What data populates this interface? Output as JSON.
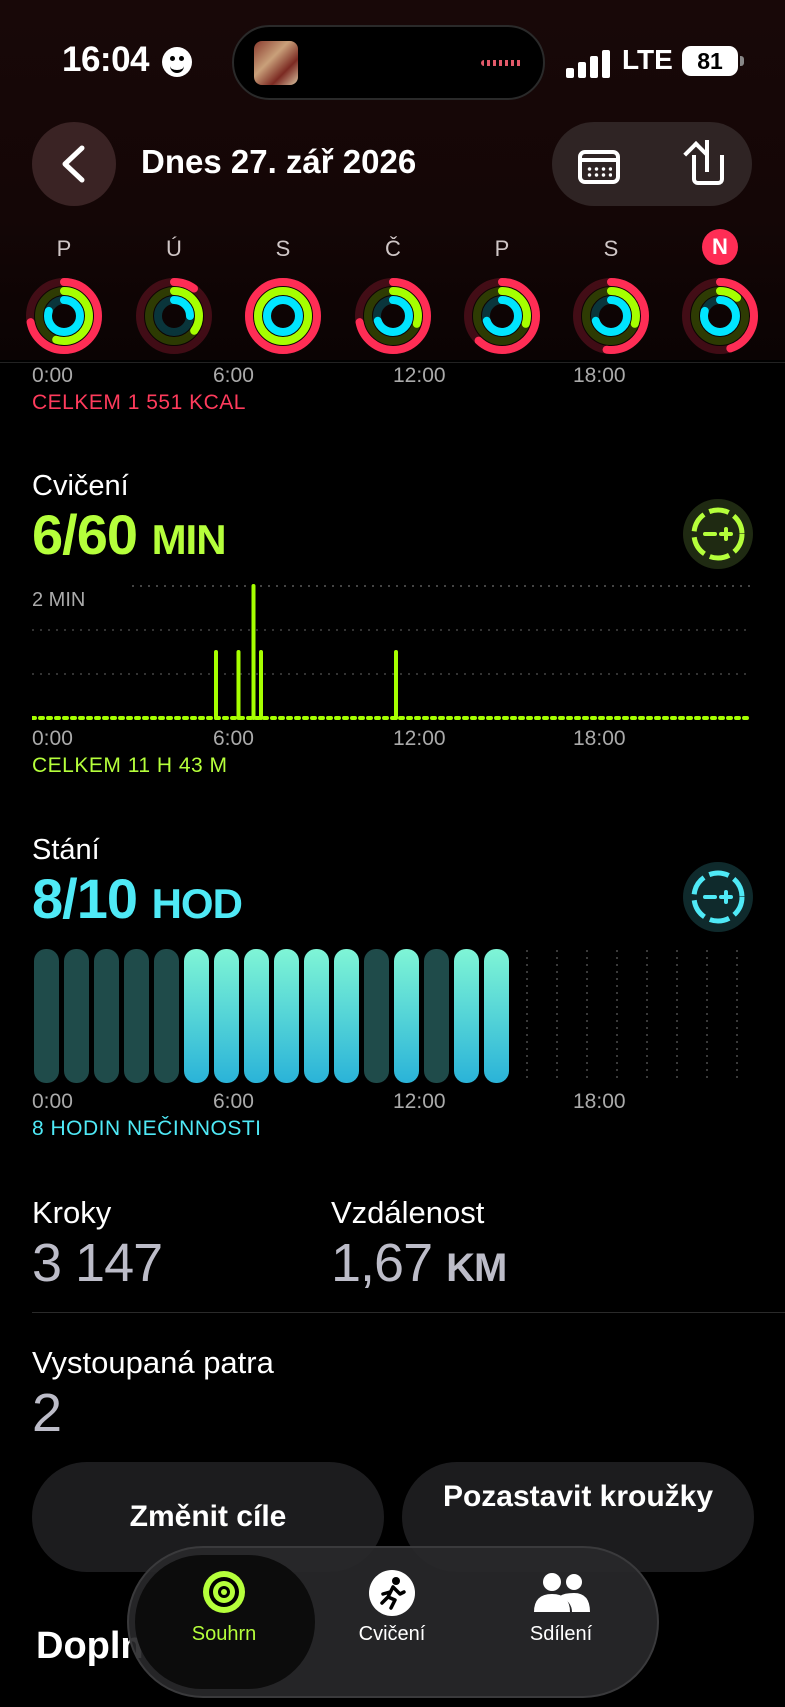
{
  "status_bar": {
    "time": "16:04",
    "network": "LTE",
    "battery": "81"
  },
  "header": {
    "title": "Dnes 27. zář 2026"
  },
  "week": {
    "days": [
      "P",
      "Ú",
      "S",
      "Č",
      "P",
      "S",
      "N"
    ],
    "rings": [
      {
        "move": 0.72,
        "exercise": 0.55,
        "stand": 0.8
      },
      {
        "move": 0.1,
        "exercise": 0.35,
        "stand": 0.25
      },
      {
        "move": 1.0,
        "exercise": 1.0,
        "stand": 1.0
      },
      {
        "move": 0.72,
        "exercise": 0.3,
        "stand": 0.7
      },
      {
        "move": 0.62,
        "exercise": 0.3,
        "stand": 0.7
      },
      {
        "move": 0.52,
        "exercise": 0.3,
        "stand": 0.7
      },
      {
        "move": 0.45,
        "exercise": 0.12,
        "stand": 0.8
      }
    ],
    "colors": {
      "move": "#ff2d55",
      "exercise": "#a6ff00",
      "stand": "#00e5ff"
    }
  },
  "move": {
    "time_axis": [
      "0:00",
      "6:00",
      "12:00",
      "18:00"
    ],
    "total": "CELKEM 1 551 KCAL"
  },
  "exercise": {
    "title": "Cvičení",
    "value": "6/60",
    "unit": "MIN",
    "time_axis": [
      "0:00",
      "6:00",
      "12:00",
      "18:00"
    ],
    "total": "CELKEM 11 H 43 M",
    "chart_data": {
      "type": "bar",
      "ylabel": "2 MIN",
      "ymax": 2,
      "bins_per_day": 96,
      "values": [
        {
          "bin": 24,
          "value": 1
        },
        {
          "bin": 27,
          "value": 1
        },
        {
          "bin": 29,
          "value": 2
        },
        {
          "bin": 30,
          "value": 1
        },
        {
          "bin": 48,
          "value": 1
        }
      ]
    }
  },
  "stand": {
    "title": "Stání",
    "value": "8/10",
    "unit": "HOD",
    "time_axis": [
      "0:00",
      "6:00",
      "12:00",
      "18:00"
    ],
    "idle": "8 HODIN NEČINNOSTI",
    "chart_data": {
      "type": "bar",
      "hours": [
        0,
        0,
        0,
        0,
        0,
        1,
        1,
        1,
        1,
        1,
        1,
        0,
        1,
        0,
        1,
        1,
        null,
        null,
        null,
        null,
        null,
        null,
        null,
        null
      ]
    }
  },
  "stats": {
    "steps_label": "Kroky",
    "steps_value": "3 147",
    "distance_label": "Vzdálenost",
    "distance_value": "1,67",
    "distance_unit": "KM",
    "floors_label": "Vystoupaná patra",
    "floors_value": "2"
  },
  "actions": {
    "change_goals": "Změnit cíle",
    "pause_rings": "Pozastavit kroužky"
  },
  "section_next": "Doplnit",
  "tabs": {
    "summary": "Souhrn",
    "workouts": "Cvičení",
    "sharing": "Sdílení"
  }
}
